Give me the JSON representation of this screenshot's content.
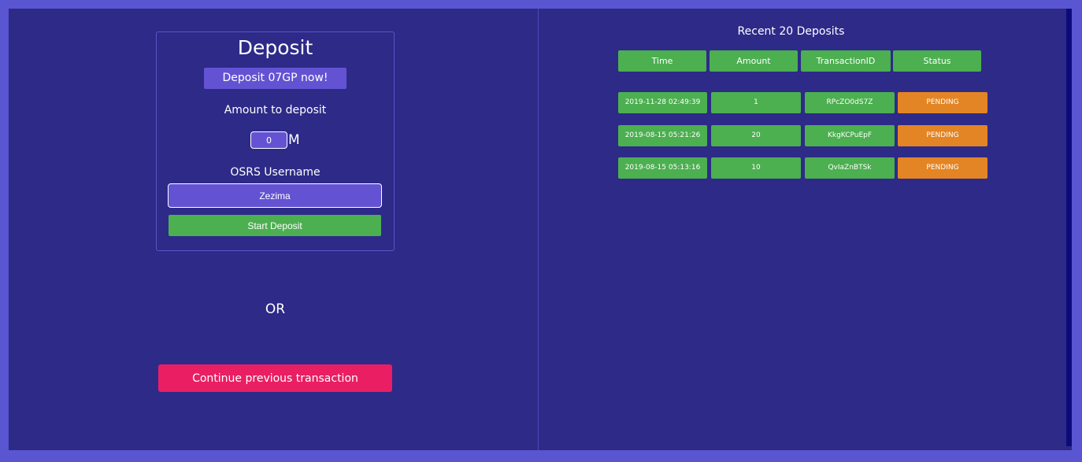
{
  "deposit": {
    "title": "Deposit",
    "promo": "Deposit 07GP now!",
    "amount_label": "Amount to deposit",
    "amount_value": "0",
    "amount_unit": "M",
    "username_label": "OSRS Username",
    "username_value": "Zezima",
    "start_button": "Start Deposit"
  },
  "or_label": "OR",
  "continue_button": "Continue previous transaction",
  "recent": {
    "title": "Recent 20 Deposits",
    "headers": [
      "Time",
      "Amount",
      "TransactionID",
      "Status"
    ],
    "rows": [
      {
        "time": "2019-11-28 02:49:39",
        "amount": "1",
        "transaction_id": "RPcZO0dS7Z",
        "status": "PENDING"
      },
      {
        "time": "2019-08-15 05:21:26",
        "amount": "20",
        "transaction_id": "KkgKCPuEpF",
        "status": "PENDING"
      },
      {
        "time": "2019-08-15 05:13:16",
        "amount": "10",
        "transaction_id": "QvIaZnBTSk",
        "status": "PENDING"
      }
    ]
  },
  "colors": {
    "page_border": "#5a55d0",
    "panel_bg": "#2d2a88",
    "accent_purple": "#6353d3",
    "success_green": "#4caf50",
    "pending_orange": "#e38524",
    "continue_pink": "#e91e63"
  }
}
